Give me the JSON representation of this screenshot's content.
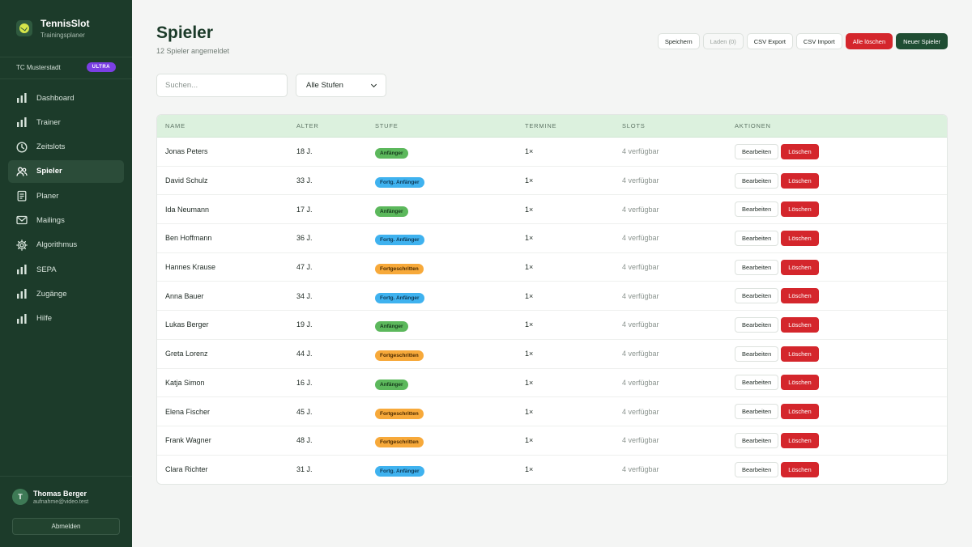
{
  "app": {
    "name": "TennisSlot",
    "subtitle": "Trainingsplaner"
  },
  "club": {
    "name": "TC Musterstadt",
    "plan": "ULTRA"
  },
  "nav": [
    {
      "label": "Dashboard",
      "icon": "bar-chart-icon",
      "active": false
    },
    {
      "label": "Trainer",
      "icon": "bar-chart-icon",
      "active": false
    },
    {
      "label": "Zeitslots",
      "icon": "clock-icon",
      "active": false
    },
    {
      "label": "Spieler",
      "icon": "users-icon",
      "active": true
    },
    {
      "label": "Planer",
      "icon": "clipboard-icon",
      "active": false
    },
    {
      "label": "Mailings",
      "icon": "mail-icon",
      "active": false
    },
    {
      "label": "Algorithmus",
      "icon": "gear-icon",
      "active": false
    },
    {
      "label": "SEPA",
      "icon": "bar-chart-icon",
      "active": false
    },
    {
      "label": "Zugänge",
      "icon": "bar-chart-icon",
      "active": false
    },
    {
      "label": "Hilfe",
      "icon": "bar-chart-icon",
      "active": false
    }
  ],
  "user": {
    "initial": "T",
    "name": "Thomas Berger",
    "email": "aufnahme@video.test",
    "logout": "Abmelden"
  },
  "page": {
    "title": "Spieler",
    "subtitle": "12 Spieler angemeldet"
  },
  "toolbar": {
    "save": "Speichern",
    "load": "Laden (0)",
    "csv_export": "CSV Export",
    "csv_import": "CSV Import",
    "delete_all": "Alle löschen",
    "new_player": "Neuer Spieler"
  },
  "filters": {
    "search_placeholder": "Suchen...",
    "level_select": "Alle Stufen"
  },
  "table": {
    "headers": [
      "NAME",
      "ALTER",
      "STUFE",
      "TERMINE",
      "SLOTS",
      "AKTIONEN"
    ],
    "edit_label": "Bearbeiten",
    "delete_label": "Löschen",
    "rows": [
      {
        "name": "Jonas Peters",
        "age": "18 J.",
        "level": "Anfänger",
        "level_color": "green",
        "dates": "1×",
        "slots": "4 verfügbar"
      },
      {
        "name": "David Schulz",
        "age": "33 J.",
        "level": "Fortg. Anfänger",
        "level_color": "blue",
        "dates": "1×",
        "slots": "4 verfügbar"
      },
      {
        "name": "Ida Neumann",
        "age": "17 J.",
        "level": "Anfänger",
        "level_color": "green",
        "dates": "1×",
        "slots": "4 verfügbar"
      },
      {
        "name": "Ben Hoffmann",
        "age": "36 J.",
        "level": "Fortg. Anfänger",
        "level_color": "blue",
        "dates": "1×",
        "slots": "4 verfügbar"
      },
      {
        "name": "Hannes Krause",
        "age": "47 J.",
        "level": "Fortgeschritten",
        "level_color": "orange",
        "dates": "1×",
        "slots": "4 verfügbar"
      },
      {
        "name": "Anna Bauer",
        "age": "34 J.",
        "level": "Fortg. Anfänger",
        "level_color": "blue",
        "dates": "1×",
        "slots": "4 verfügbar"
      },
      {
        "name": "Lukas Berger",
        "age": "19 J.",
        "level": "Anfänger",
        "level_color": "green",
        "dates": "1×",
        "slots": "4 verfügbar"
      },
      {
        "name": "Greta Lorenz",
        "age": "44 J.",
        "level": "Fortgeschritten",
        "level_color": "orange",
        "dates": "1×",
        "slots": "4 verfügbar"
      },
      {
        "name": "Katja Simon",
        "age": "16 J.",
        "level": "Anfänger",
        "level_color": "green",
        "dates": "1×",
        "slots": "4 verfügbar"
      },
      {
        "name": "Elena Fischer",
        "age": "45 J.",
        "level": "Fortgeschritten",
        "level_color": "orange",
        "dates": "1×",
        "slots": "4 verfügbar"
      },
      {
        "name": "Frank Wagner",
        "age": "48 J.",
        "level": "Fortgeschritten",
        "level_color": "orange",
        "dates": "1×",
        "slots": "4 verfügbar"
      },
      {
        "name": "Clara Richter",
        "age": "31 J.",
        "level": "Fortg. Anfänger",
        "level_color": "blue",
        "dates": "1×",
        "slots": "4 verfügbar"
      }
    ]
  }
}
